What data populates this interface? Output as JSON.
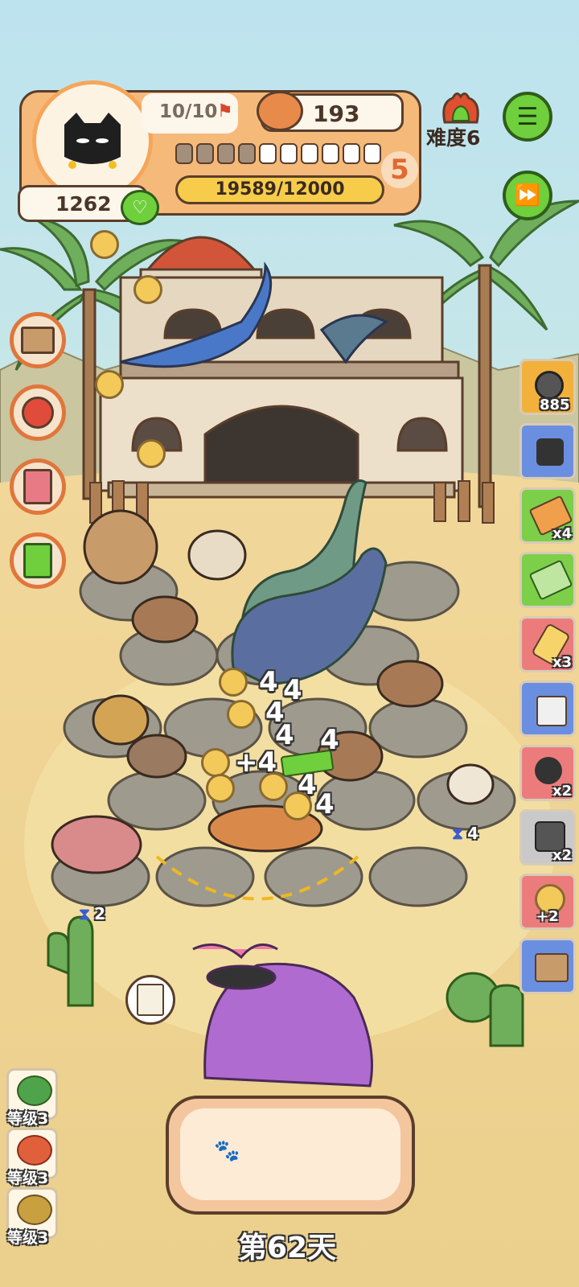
{
  "hud": {
    "avatar_icon": "black-cat-icon",
    "stamina": "10/10",
    "food_count": "193",
    "coins": "1262",
    "level_badge": "5",
    "progress_text": "19589/12000",
    "progress_segments_total": 10,
    "progress_segments_filled": 4,
    "difficulty": "难度6"
  },
  "right_items": [
    {
      "icon": "film-reel-icon",
      "count": "885",
      "color": "#f2b13c"
    },
    {
      "icon": "camera-tool-icon",
      "count": "",
      "color": "#6b8fe0"
    },
    {
      "icon": "ticket-icon",
      "count": "x4",
      "color": "#7dcf4a"
    },
    {
      "icon": "coupon-icon",
      "count": "",
      "color": "#7dcf4a"
    },
    {
      "icon": "rope-bottle-icon",
      "count": "x3",
      "color": "#ec7c7c"
    },
    {
      "icon": "grinder-icon",
      "count": "",
      "color": "#6b8fe0"
    },
    {
      "icon": "device-icon",
      "count": "x2",
      "color": "#ec7c7c"
    },
    {
      "icon": "compass-tool-icon",
      "count": "x2",
      "color": "#c9c9c9"
    },
    {
      "icon": "paw-plus-icon",
      "count": "+2",
      "color": "#ec7c7c"
    },
    {
      "icon": "basket-icon",
      "count": "",
      "color": "#6b8fe0"
    }
  ],
  "left_buttons": [
    {
      "icon": "box-icon"
    },
    {
      "icon": "lucky-cat-icon"
    },
    {
      "icon": "cat-tree-icon"
    },
    {
      "icon": "medkit-icon"
    }
  ],
  "level_items": [
    {
      "icon": "green-blob-icon",
      "label": "等级3",
      "color": "#4fa34a"
    },
    {
      "icon": "red-blob-icon",
      "label": "等级3",
      "color": "#e0603c"
    },
    {
      "icon": "spotted-egg-icon",
      "label": "等级3",
      "color": "#c8a040"
    }
  ],
  "floating_numbers": [
    "4",
    "4",
    "4",
    "4",
    "+4",
    "4",
    "4",
    "4"
  ],
  "timers": [
    "4",
    "2"
  ],
  "day_label": "第62天"
}
